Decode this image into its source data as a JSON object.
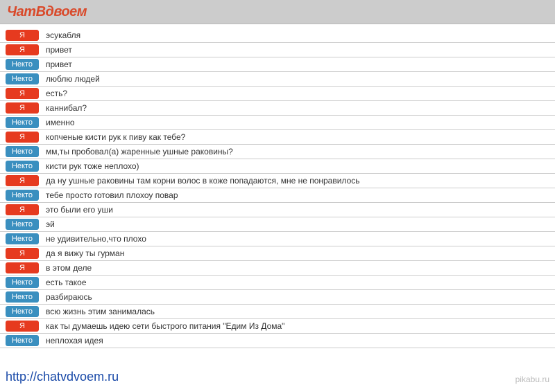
{
  "header": {
    "title": "ЧатВдвоем"
  },
  "labels": {
    "me": "Я",
    "them": "Некто"
  },
  "messages": [
    {
      "who": "me",
      "text": "эсукабля"
    },
    {
      "who": "me",
      "text": "привет"
    },
    {
      "who": "them",
      "text": "привет"
    },
    {
      "who": "them",
      "text": "люблю людей"
    },
    {
      "who": "me",
      "text": "есть?"
    },
    {
      "who": "me",
      "text": "каннибал?"
    },
    {
      "who": "them",
      "text": "именно"
    },
    {
      "who": "me",
      "text": "копченые кисти рук к пиву как тебе?"
    },
    {
      "who": "them",
      "text": "мм,ты пробовал(а) жаренные ушные раковины?"
    },
    {
      "who": "them",
      "text": "кисти рук тоже неплохо)"
    },
    {
      "who": "me",
      "text": "да ну ушные раковины там корни волос в коже попадаются, мне не понравилось"
    },
    {
      "who": "them",
      "text": "тебе просто готовил плохоу повар"
    },
    {
      "who": "me",
      "text": "это были его уши"
    },
    {
      "who": "them",
      "text": "эй"
    },
    {
      "who": "them",
      "text": "не удивительно,что плохо"
    },
    {
      "who": "me",
      "text": "да я вижу ты гурман"
    },
    {
      "who": "me",
      "text": "в этом деле"
    },
    {
      "who": "them",
      "text": "есть такое"
    },
    {
      "who": "them",
      "text": "разбираюсь"
    },
    {
      "who": "them",
      "text": "всю жизнь этим занималась"
    },
    {
      "who": "me",
      "text": "как ты думаешь идею сети быстрого питания \"Едим Из Дома\""
    },
    {
      "who": "them",
      "text": "неплохая идея"
    }
  ],
  "footer": {
    "url": "http://chatvdvoem.ru",
    "watermark": "pikabu.ru"
  }
}
